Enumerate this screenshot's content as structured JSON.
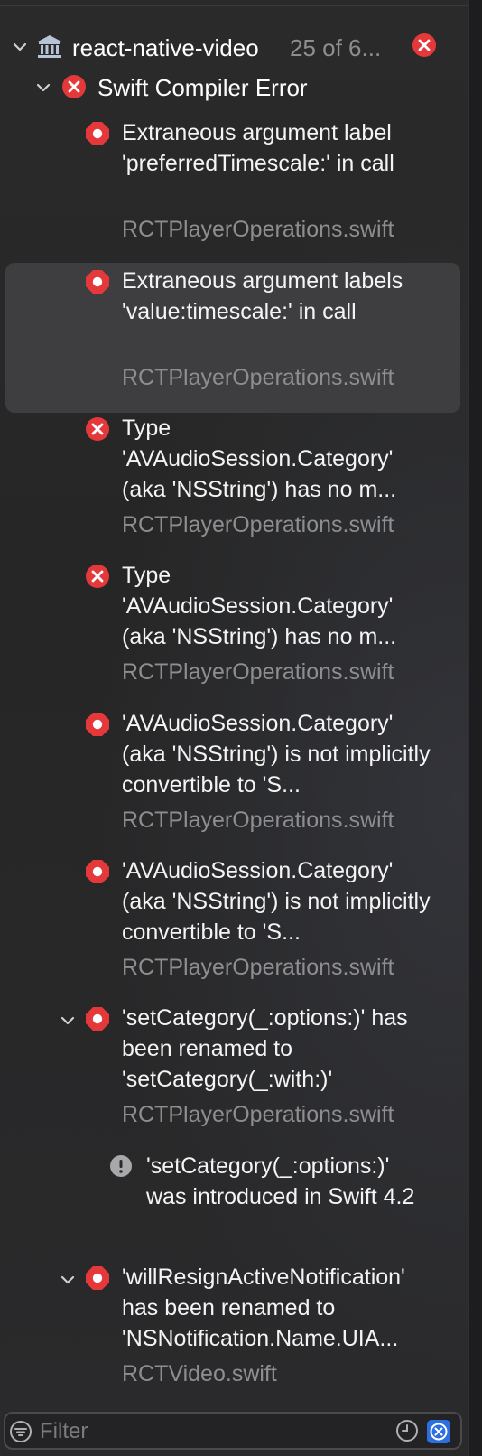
{
  "project": {
    "name": "react-native-video",
    "count": "25 of 6..."
  },
  "group": {
    "title": "Swift Compiler Error"
  },
  "issues": [
    {
      "type": "error",
      "message": "Extraneous argument label 'preferredTimescale:' in call",
      "file": "RCTPlayerOperations.swift",
      "lines": 3
    },
    {
      "type": "error",
      "message": "Extraneous argument labels 'value:timescale:' in call",
      "file": "RCTPlayerOperations.swift",
      "lines": 3,
      "selected": true
    },
    {
      "type": "error-x",
      "message": "Type 'AVAudioSession.Category' (aka 'NSString') has no m...",
      "file": "RCTPlayerOperations.swift",
      "lines": 3
    },
    {
      "type": "error-x",
      "message": "Type 'AVAudioSession.Category' (aka 'NSString') has no m...",
      "file": "RCTPlayerOperations.swift",
      "lines": 3
    },
    {
      "type": "error",
      "message": "'AVAudioSession.Category' (aka 'NSString') is not implicitly convertible to 'S...",
      "file": "RCTPlayerOperations.swift",
      "lines": 3
    },
    {
      "type": "error",
      "message": "'AVAudioSession.Category' (aka 'NSString') is not implicitly convertible to 'S...",
      "file": "RCTPlayerOperations.swift",
      "lines": 3
    },
    {
      "type": "error",
      "message": "'setCategory(_:options:)' has been renamed to 'setCategory(_:with:)'",
      "file": "RCTPlayerOperations.swift",
      "lines": 3,
      "expandable": true
    },
    {
      "type": "note",
      "message": "'setCategory(_:options:)' was introduced in Swift 4.2",
      "file": "",
      "lines": 3
    },
    {
      "type": "error",
      "message": "'willResignActiveNotification' has been renamed to 'NSNotification.Name.UIA...",
      "file": "RCTVideo.swift",
      "lines": 3,
      "expandable": true
    }
  ],
  "filter": {
    "placeholder": "Filter"
  },
  "colors": {
    "error": "#e5383b",
    "note": "#a8a8aa",
    "selected": "#3e3e40"
  }
}
